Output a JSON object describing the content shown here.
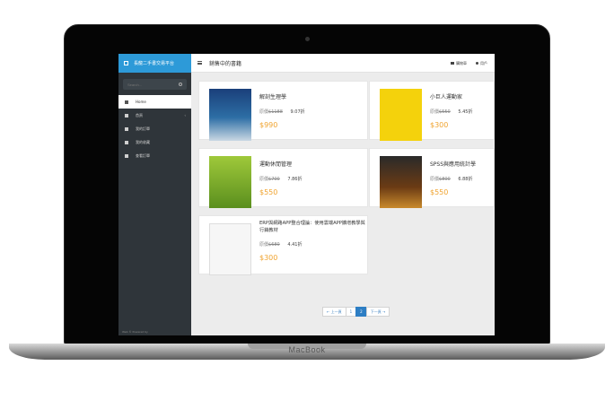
{
  "laptop": {
    "brand": "MacBook"
  },
  "sidebar": {
    "brand_title": "長龍二手書交易平台",
    "search_placeholder": "Search...",
    "items": [
      {
        "label": "Home"
      },
      {
        "label": "首頁"
      },
      {
        "label": "我的訂單"
      },
      {
        "label": "我的收藏"
      },
      {
        "label": "查看訂單"
      }
    ]
  },
  "header": {
    "title": "銷售中的書籍",
    "cart_label": "購物車",
    "user_label": "用戶"
  },
  "books": [
    {
      "title": "解剖生理學",
      "orig_label": "原價",
      "orig_price": "$1188",
      "discount": "9.07折",
      "price": "$990"
    },
    {
      "title": "小巨人運動家",
      "orig_label": "原價",
      "orig_price": "$550",
      "discount": "5.45折",
      "price": "$300"
    },
    {
      "title": "運動休閒管理",
      "orig_label": "原價",
      "orig_price": "$700",
      "discount": "7.86折",
      "price": "$550"
    },
    {
      "title": "SPSS與應用統計學",
      "orig_label": "原價",
      "orig_price": "$800",
      "discount": "6.88折",
      "price": "$550"
    },
    {
      "title": "ERP與網路APP整合理論：使用雲端APP擴增教學與行銷教材",
      "orig_label": "原價",
      "orig_price": "$680",
      "discount": "4.41折",
      "price": "$300"
    }
  ],
  "pager": {
    "prev": "← 上一頁",
    "page1": "1",
    "page2": "2",
    "next": "下一頁 →"
  },
  "footer": {
    "note": "Web © Powered by"
  },
  "colors": {
    "sidebar": "#2f353a",
    "brand": "#2d9ad8",
    "price": "#f0a431",
    "active_page": "#2d7ec4"
  }
}
